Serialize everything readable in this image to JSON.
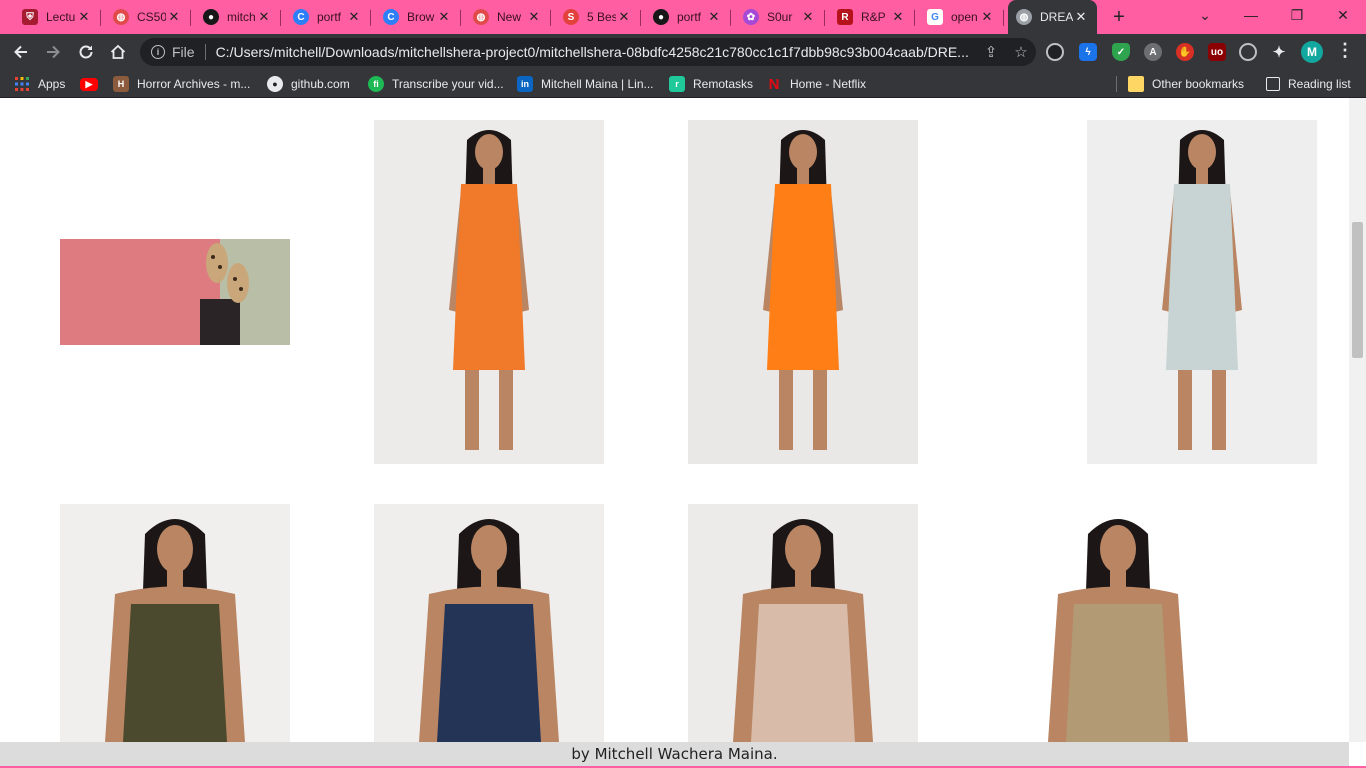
{
  "browser": {
    "tabs": [
      {
        "title": "Lectu",
        "favicon": "harvard-shield-icon",
        "color": "#a51c30"
      },
      {
        "title": "CS50",
        "favicon": "globe-icon",
        "color": "#e24a4a"
      },
      {
        "title": "mitch",
        "favicon": "github-icon",
        "color": "#181717"
      },
      {
        "title": "portf",
        "favicon": "canva-icon",
        "color": "#2d7ff9"
      },
      {
        "title": "Brow",
        "favicon": "canva-icon",
        "color": "#2d7ff9"
      },
      {
        "title": "New",
        "favicon": "globe-icon",
        "color": "#e24a4a"
      },
      {
        "title": "5 Bes",
        "favicon": "s-logo-icon",
        "color": "#e2413c"
      },
      {
        "title": "portf",
        "favicon": "github-icon",
        "color": "#181717"
      },
      {
        "title": "S0ur",
        "favicon": "flower-icon",
        "color": "#a64ad6"
      },
      {
        "title": "R&P",
        "favicon": "rp-logo-icon",
        "color": "#b5121b"
      },
      {
        "title": "open",
        "favicon": "google-icon",
        "color": "#ffffff"
      },
      {
        "title": "DREA",
        "favicon": "globe-icon",
        "color": "#9aa0a6",
        "active": true
      }
    ],
    "address": {
      "scheme": "File",
      "url": "C:/Users/mitchell/Downloads/mitchellshera-project0/mitchellshera-08bdfc4258c21c780cc1c1f7dbb98c93b004caab/DRE..."
    },
    "profile_initial": "M",
    "bookmarks": [
      {
        "label": "Apps",
        "icon": "apps-grid-icon"
      },
      {
        "label": "",
        "icon": "youtube-icon"
      },
      {
        "label": "Horror Archives - m...",
        "icon": "horror-archives-icon"
      },
      {
        "label": "github.com",
        "icon": "github-icon"
      },
      {
        "label": "Transcribe your vid...",
        "icon": "otter-icon"
      },
      {
        "label": "Mitchell Maina | Lin...",
        "icon": "linkedin-icon"
      },
      {
        "label": "Remotasks",
        "icon": "remotasks-icon"
      },
      {
        "label": "Home - Netflix",
        "icon": "netflix-icon"
      },
      {
        "label": "Other bookmarks",
        "icon": "folder-icon"
      },
      {
        "label": "Reading list",
        "icon": "reading-list-icon"
      }
    ]
  },
  "page": {
    "products": [
      {
        "name": "leopard-flats-photo",
        "bg": "#dd7b80",
        "garment": "#c9a77a"
      },
      {
        "name": "orange-satin-dress-photo",
        "bg": "#ecebea",
        "garment": "#f07a2a"
      },
      {
        "name": "orange-mesh-dress-photo",
        "bg": "#e9e8e7",
        "garment": "#ff7e16"
      },
      {
        "name": "silver-satin-dress-photo",
        "bg": "#efeeee",
        "garment": "#c8d4d3"
      },
      {
        "name": "olive-top-leather-skirt-photo",
        "bg": "#f0efee",
        "garment": "#4b4a2e"
      },
      {
        "name": "navy-jumpsuit-photo",
        "bg": "#efeeed",
        "garment": "#243456"
      },
      {
        "name": "beige-knit-set-photo",
        "bg": "#ecebea",
        "garment": "#d8bba8"
      },
      {
        "name": "leopard-jeans-photo",
        "bg": "#ffffff",
        "garment": "#b29a75"
      }
    ],
    "footer": "by Mitchell Wachera Maina."
  }
}
